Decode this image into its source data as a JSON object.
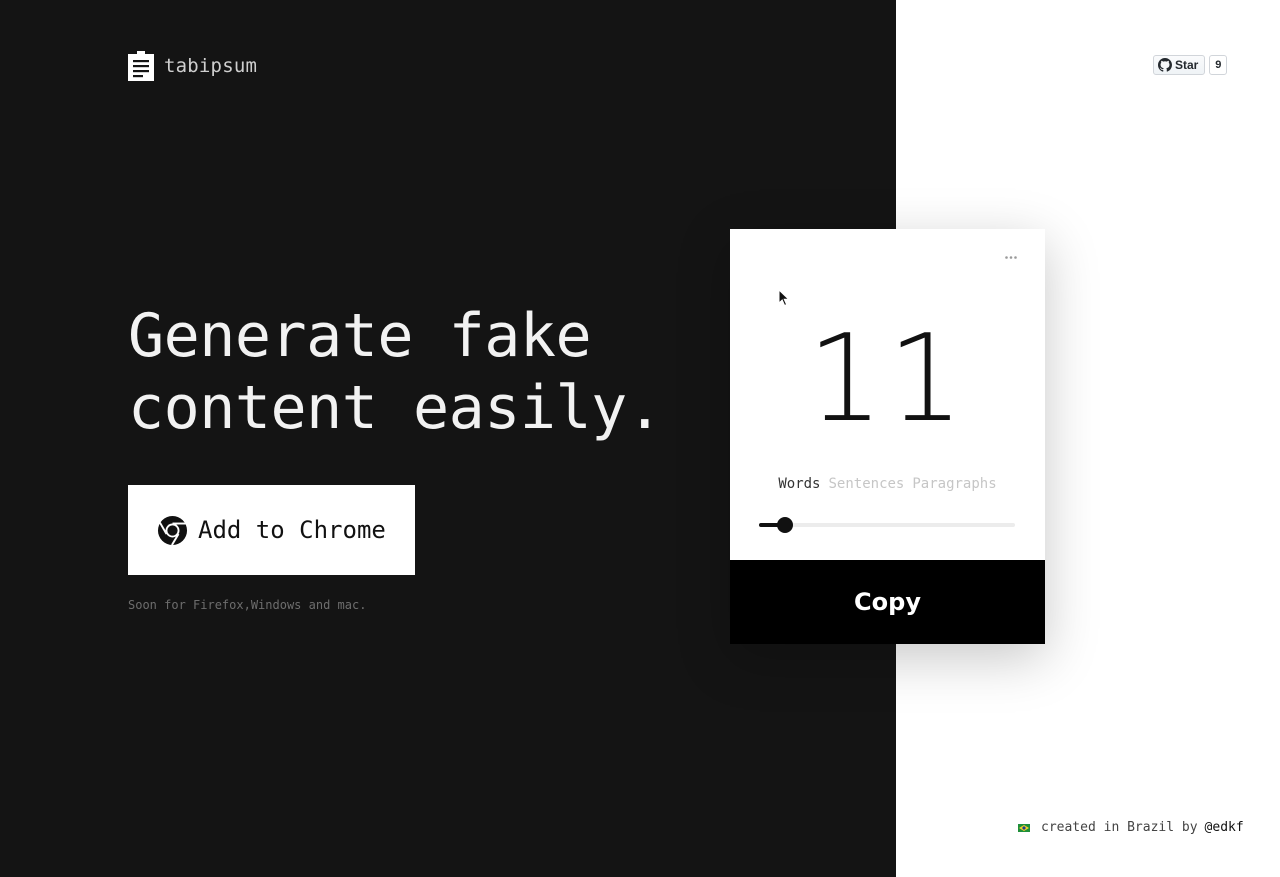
{
  "brand": {
    "name": "tabipsum",
    "logo_icon": "clipboard-icon"
  },
  "hero": {
    "line1": "Generate fake",
    "line2": "content easily.",
    "cta_label": "Add to Chrome",
    "cta_icon": "chrome-icon",
    "note": "Soon for Firefox,Windows and mac."
  },
  "github": {
    "icon": "github-icon",
    "star_label": "Star",
    "star_count": "9"
  },
  "popup": {
    "menu_icon": "more-icon",
    "count": "11",
    "modes": [
      {
        "label": "Words",
        "active": true
      },
      {
        "label": "Sentences",
        "active": false
      },
      {
        "label": "Paragraphs",
        "active": false
      }
    ],
    "slider_fraction": 0.1,
    "copy_label": "Copy"
  },
  "footer": {
    "flag_icon": "brazil-flag-icon",
    "text": "created in Brazil by",
    "link": "@edkf"
  },
  "colors": {
    "dark_panel": "#141414",
    "light_panel": "#ffffff",
    "accent": "#000000"
  }
}
